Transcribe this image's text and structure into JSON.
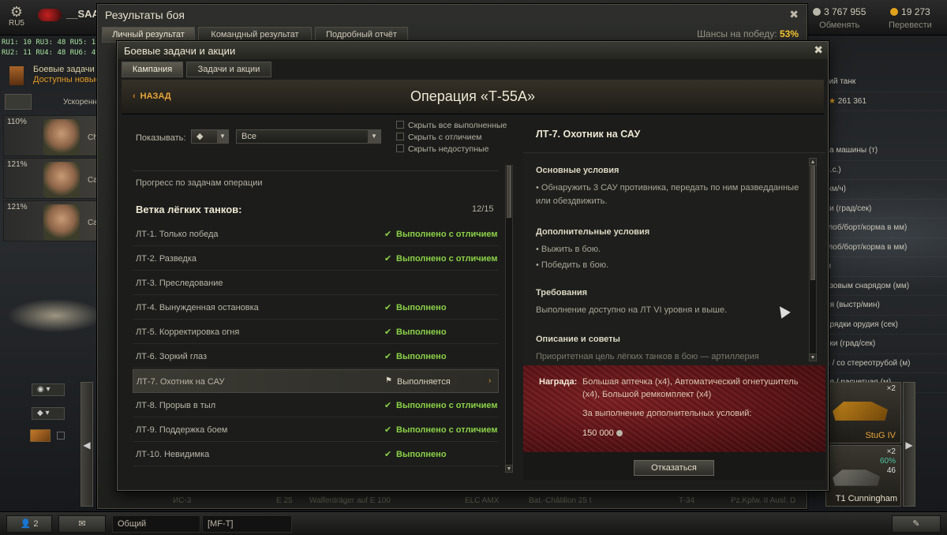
{
  "topbar": {
    "settings_label": "RU5",
    "player_name": "__SAA",
    "credits": "3 767 955",
    "credits_action": "Обменять",
    "gold": "19 273",
    "gold_action": "Перевести"
  },
  "servers": [
    "RU1: 10  RU3: 48  RU5: 11",
    "RU2: 11  RU4: 48  RU6: 49"
  ],
  "left_panel": {
    "tasks_label": "Боевые задачи",
    "tasks_sub": "Доступны новые",
    "accel_label": "Ускоренн",
    "crew": [
      {
        "pct": "110%",
        "name": "Ch"
      },
      {
        "pct": "121%",
        "name": "Ca"
      },
      {
        "pct": "121%",
        "name": "Ca"
      }
    ]
  },
  "right_stats": {
    "tank_type": "кий танк",
    "xp": "261 361",
    "rows": [
      "са машины (т)",
      "л.с.)",
      "(км/ч)",
      "си (град/сек)",
      "(лоб/борт/корма в мм)",
      "(лоб/борт/корма в мм)",
      "м",
      "азовым снарядом (мм)",
      "ия (выстр/мин)",
      "арядки орудия (сек)",
      "нки (град/сек)",
      "л / со стереотрубой (м)",
      "ая / расчетная (м)"
    ]
  },
  "tank_cards": [
    {
      "name": "StuG IV",
      "mult": "×2"
    },
    {
      "name": "T1 Cunningham",
      "mult": "×2",
      "pct": "60%",
      "count": "46"
    }
  ],
  "bottom_bar": {
    "players": "2",
    "channel": "Общий",
    "tag": "[MF-T]"
  },
  "results_window": {
    "title": "Результаты боя",
    "tabs": [
      "Личный результат",
      "Командный результат",
      "Подробный отчёт"
    ],
    "chance_label": "Шансы на победу:",
    "chance_value": "53%",
    "bottom_tanks": [
      "ИС-3",
      "E 25",
      "Waffenträger auf E 100",
      "ELC AMX",
      "Bat.-Châtillon 25 t",
      "T-34",
      "Pz.Kpfw. II Ausf. D"
    ]
  },
  "tasks_window": {
    "title": "Боевые задачи и акции",
    "tabs": [
      "Кампания",
      "Задачи и акции"
    ],
    "back_label": "НАЗАД",
    "operation_title": "Операция «Т-55А»",
    "filter": {
      "show_label": "Показывать:",
      "select_value": "Все",
      "checkboxes": [
        "Скрыть все выполненные",
        "Скрыть с отличием",
        "Скрыть недоступные"
      ]
    },
    "progress_label": "Прогресс по задачам операции",
    "branch_title": "Ветка лёгких танков:",
    "branch_count": "12/15",
    "tasks": [
      {
        "name": "ЛТ-1. Только победа",
        "status": "Выполнено с отличием",
        "state": "done"
      },
      {
        "name": "ЛТ-2. Разведка",
        "status": "Выполнено с отличием",
        "state": "done"
      },
      {
        "name": "ЛТ-3. Преследование",
        "status": "",
        "state": "none"
      },
      {
        "name": "ЛТ-4. Вынужденная остановка",
        "status": "Выполнено",
        "state": "done"
      },
      {
        "name": "ЛТ-5. Корректировка огня",
        "status": "Выполнено",
        "state": "done"
      },
      {
        "name": "ЛТ-6. Зоркий глаз",
        "status": "Выполнено",
        "state": "done"
      },
      {
        "name": "ЛТ-7. Охотник на САУ",
        "status": "Выполняется",
        "state": "progress"
      },
      {
        "name": "ЛТ-8. Прорыв в тыл",
        "status": "Выполнено с отличием",
        "state": "done"
      },
      {
        "name": "ЛТ-9. Поддержка боем",
        "status": "Выполнено с отличием",
        "state": "done"
      },
      {
        "name": "ЛТ-10. Невидимка",
        "status": "Выполнено",
        "state": "done"
      }
    ],
    "detail": {
      "title": "ЛТ-7. Охотник на САУ",
      "main_h": "Основные условия",
      "main_t": "• Обнаружить 3 САУ противника, передать по ним разведданные или обездвижить.",
      "extra_h": "Дополнительные условия",
      "extra_t1": "• Выжить в бою.",
      "extra_t2": "• Победить в бою.",
      "req_h": "Требования",
      "req_t": "Выполнение доступно на ЛТ VI уровня и выше.",
      "desc_h": "Описание и советы",
      "desc_t": "Приоритетная цель лёгких танков в бою — артиллерия противника.",
      "reward_label": "Награда:",
      "reward_text": "Большая аптечка (x4), Автоматический огнетушитель (x4), Большой ремкомплект (x4)",
      "reward_additional": "За выполнение дополнительных условий:",
      "reward_amount": "150 000",
      "decline_label": "Отказаться"
    }
  }
}
